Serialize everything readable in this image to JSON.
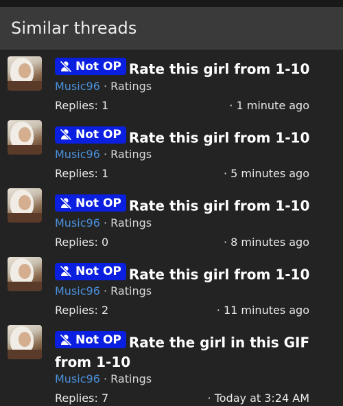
{
  "header": {
    "title": "Similar threads"
  },
  "badge_label": "Not OP",
  "threads": [
    {
      "title": "Rate this girl from 1-10",
      "user": "Music96",
      "forum": "Ratings",
      "replies": "Replies: 1",
      "time": "1 minute ago"
    },
    {
      "title": "Rate this girl from 1-10",
      "user": "Music96",
      "forum": "Ratings",
      "replies": "Replies: 1",
      "time": "5 minutes ago"
    },
    {
      "title": "Rate this girl from 1-10",
      "user": "Music96",
      "forum": "Ratings",
      "replies": "Replies: 0",
      "time": "8 minutes ago"
    },
    {
      "title": "Rate this girl from 1-10",
      "user": "Music96",
      "forum": "Ratings",
      "replies": "Replies: 2",
      "time": "11 minutes ago"
    },
    {
      "title": "Rate the girl in this GIF from 1-10",
      "user": "Music96",
      "forum": "Ratings",
      "replies": "Replies: 7",
      "time": "Today at 3:24 AM"
    }
  ],
  "separator": "·",
  "colors": {
    "badge": "#0a1fe0",
    "username": "#4a90d9",
    "background": "#232324",
    "header": "#3a3a3a"
  },
  "icons": {
    "badge_icon": "user-slash-icon"
  }
}
